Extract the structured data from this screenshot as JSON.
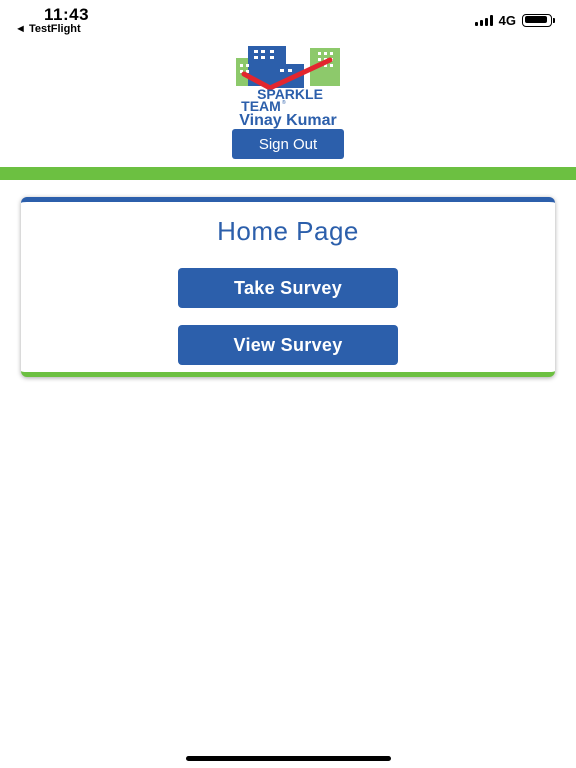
{
  "status_bar": {
    "time": "11:43",
    "back_label": "◄ TestFlight",
    "network": "4G"
  },
  "header": {
    "logo_text_line1": "SPARKLE",
    "logo_text_line2": "TEAM",
    "logo_trademark": "®",
    "user_name": "Vinay Kumar",
    "sign_out_label": "Sign Out"
  },
  "home": {
    "title": "Home Page",
    "take_survey_label": "Take Survey",
    "view_survey_label": "View Survey"
  },
  "colors": {
    "primary_blue": "#2c5fab",
    "accent_green": "#6cc041",
    "check_red": "#e3262e"
  },
  "icons": {
    "signal": "signal-bars-icon",
    "battery": "battery-icon",
    "logo": "sparkle-team-logo"
  }
}
